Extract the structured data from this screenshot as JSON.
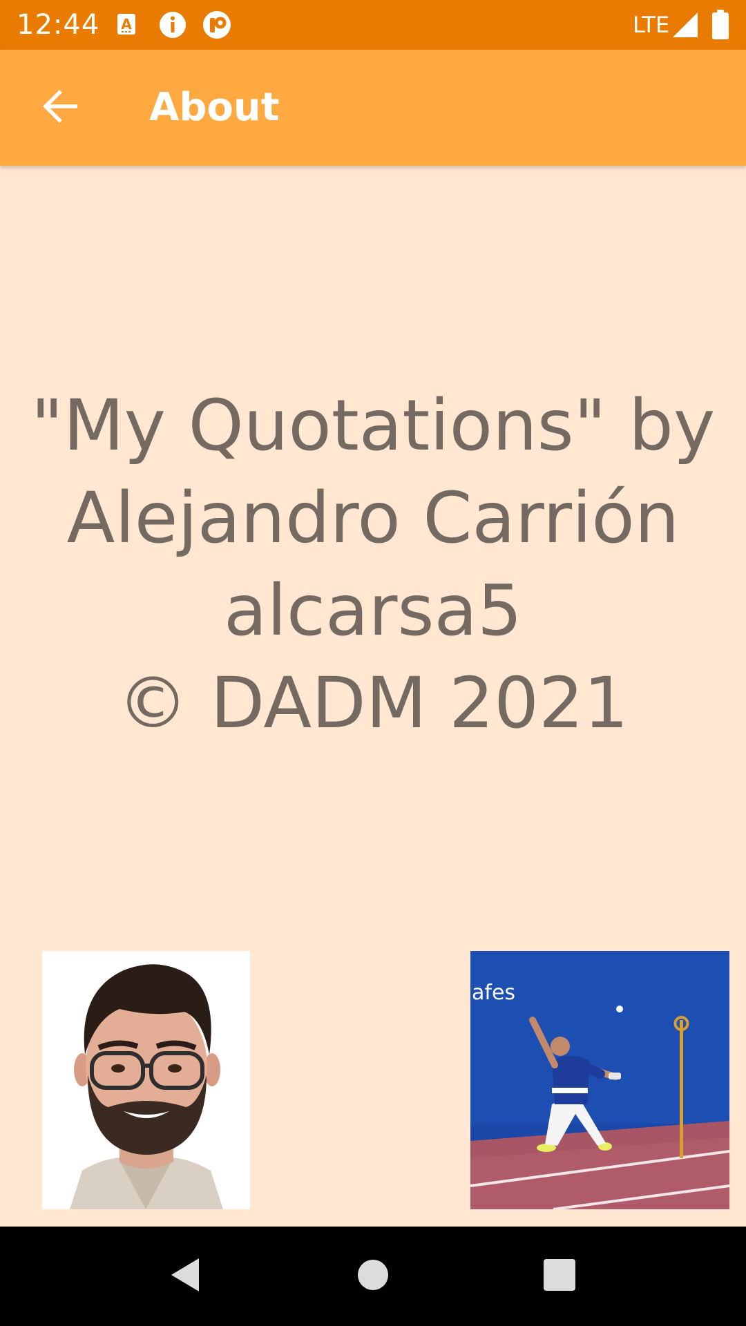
{
  "status_bar": {
    "time": "12:44",
    "network": "LTE",
    "icons": [
      "text-a-icon",
      "info-icon",
      "app-notification-icon",
      "signal-icon",
      "battery-icon"
    ],
    "background": "#E87B00"
  },
  "app_bar": {
    "title": "About",
    "back_icon": "arrow-left-icon",
    "background": "#FFA940"
  },
  "about": {
    "lines": [
      "\"My Quotations\" by",
      "Alejandro Carrión",
      "alcarsa5",
      "© DADM 2021"
    ],
    "text_color": "#746A62"
  },
  "page": {
    "background": "#FFE7D1"
  },
  "nav_bar": {
    "icons": [
      "back-triangle-icon",
      "home-circle-icon",
      "recents-square-icon"
    ]
  }
}
